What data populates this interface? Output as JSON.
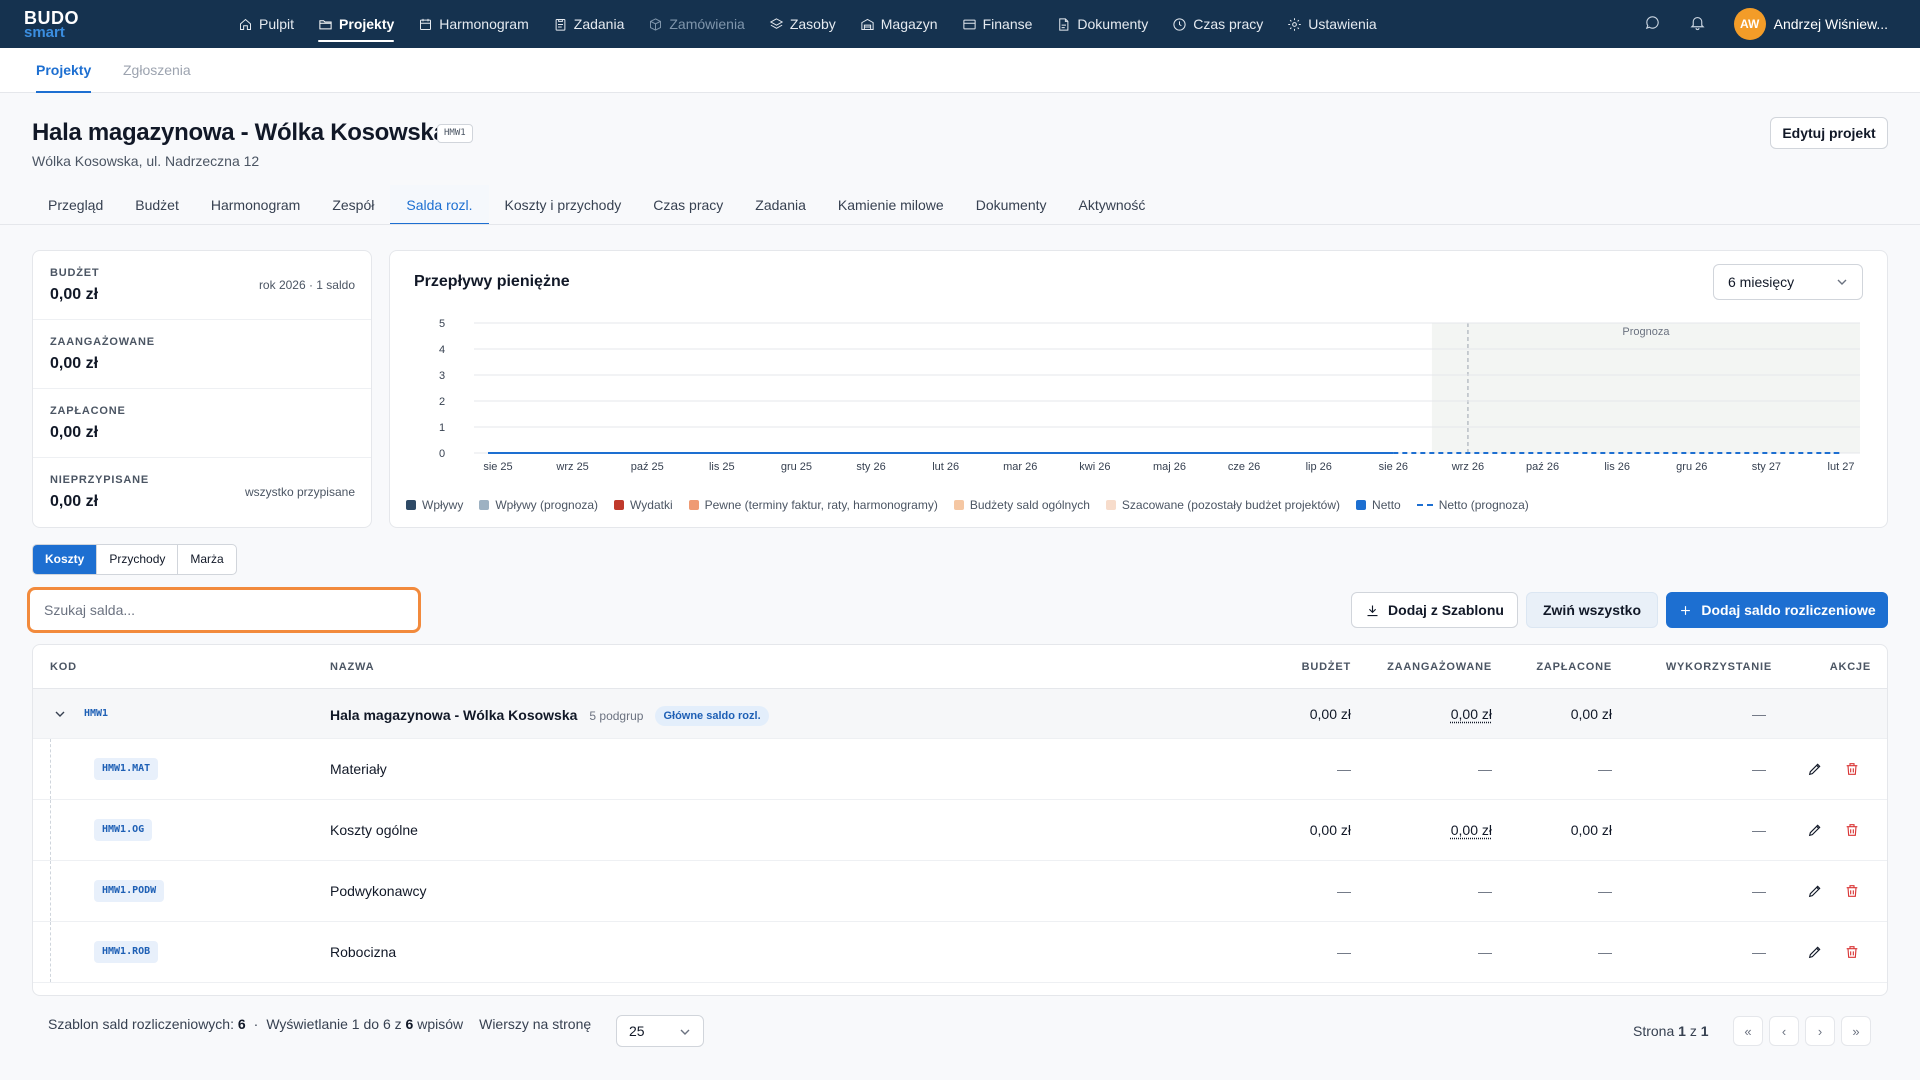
{
  "brand": {
    "line1": "BUDO",
    "line2": "smart"
  },
  "nav": {
    "items": [
      {
        "label": "Pulpit",
        "icon": "home-icon"
      },
      {
        "label": "Projekty",
        "icon": "folder-icon"
      },
      {
        "label": "Harmonogram",
        "icon": "calendar-icon"
      },
      {
        "label": "Zadania",
        "icon": "clipboard-icon"
      },
      {
        "label": "Zamówienia",
        "icon": "package-icon"
      },
      {
        "label": "Zasoby",
        "icon": "layers-icon"
      },
      {
        "label": "Magazyn",
        "icon": "warehouse-icon"
      },
      {
        "label": "Finanse",
        "icon": "credit-card-icon"
      },
      {
        "label": "Dokumenty",
        "icon": "document-icon"
      },
      {
        "label": "Czas pracy",
        "icon": "clock-icon"
      },
      {
        "label": "Ustawienia",
        "icon": "gear-icon"
      }
    ],
    "active": "Projekty",
    "user": {
      "initials": "AW",
      "name": "Andrzej Wiśniew..."
    }
  },
  "subtabs": [
    "Projekty",
    "Zgłoszenia"
  ],
  "project": {
    "title": "Hala magazynowa - Wólka Kosowska",
    "code": "HMW1",
    "address": "Wólka Kosowska, ul. Nadrzeczna 12",
    "edit_label": "Edytuj projekt"
  },
  "project_tabs": [
    "Przegląd",
    "Budżet",
    "Harmonogram",
    "Zespół",
    "Salda rozl.",
    "Koszty i przychody",
    "Czas pracy",
    "Zadania",
    "Kamienie milowe",
    "Dokumenty",
    "Aktywność"
  ],
  "summary": [
    {
      "label": "BUDŻET",
      "value": "0,00 zł",
      "note": "rok 2026 · 1 saldo"
    },
    {
      "label": "ZAANGAŻOWANE",
      "value": "0,00 zł",
      "note": ""
    },
    {
      "label": "ZAPŁACONE",
      "value": "0,00 zł",
      "note": ""
    },
    {
      "label": "NIEPRZYPISANE",
      "value": "0,00 zł",
      "note": "wszystko przypisane"
    }
  ],
  "chart_panel": {
    "title": "Przepływy pieniężne",
    "period": "6 miesięcy"
  },
  "chart_data": {
    "type": "line",
    "categories": [
      "sie 25",
      "wrz 25",
      "paź 25",
      "lis 25",
      "gru 25",
      "sty 26",
      "lut 26",
      "mar 26",
      "kwi 26",
      "maj 26",
      "cze 26",
      "lip 26",
      "sie 26",
      "wrz 26",
      "paź 26",
      "lis 26",
      "gru 26",
      "sty 27",
      "lut 27"
    ],
    "ylim": [
      0,
      5
    ],
    "yticks": [
      0,
      1,
      2,
      3,
      4,
      5
    ],
    "forecast_start": "wrz 26",
    "forecast_label": "Prognoza",
    "series": [
      {
        "name": "Netto",
        "values": [
          0,
          0,
          0,
          0,
          0,
          0,
          0,
          0,
          0,
          0,
          0,
          0,
          0,
          null,
          null,
          null,
          null,
          null,
          null
        ],
        "color": "#1d6fd1"
      },
      {
        "name": "Netto (prognoza)",
        "values": [
          null,
          null,
          null,
          null,
          null,
          null,
          null,
          null,
          null,
          null,
          null,
          null,
          0,
          0,
          0,
          0,
          0,
          0,
          0
        ],
        "color": "#1d6fd1",
        "dashed": true
      }
    ],
    "legend": [
      {
        "name": "Wpływy",
        "color": "#2e4a66"
      },
      {
        "name": "Wpływy (prognoza)",
        "color": "#9db1c2"
      },
      {
        "name": "Wydatki",
        "color": "#c0392b"
      },
      {
        "name": "Pewne (terminy faktur, raty, harmonogramy)",
        "color": "#ef9a73"
      },
      {
        "name": "Budżety sald ogólnych",
        "color": "#f5c7a3"
      },
      {
        "name": "Szacowane (pozostały budżet projektów)",
        "color": "#f7dccb"
      },
      {
        "name": "Netto",
        "color": "#1d6fd1"
      },
      {
        "name": "Netto (prognoza)",
        "color": "#1d6fd1",
        "dashed": true
      }
    ]
  },
  "segments": [
    "Koszty",
    "Przychody",
    "Marża"
  ],
  "search": {
    "placeholder": "Szukaj salda..."
  },
  "actions": {
    "template": "Dodaj z Szablonu",
    "collapse": "Zwiń wszystko",
    "add": "Dodaj saldo rozliczeniowe"
  },
  "table": {
    "headers": {
      "code": "KOD",
      "name": "NAZWA",
      "budget": "BUDŻET",
      "committed": "ZAANGAŻOWANE",
      "paid": "ZAPŁACONE",
      "usage": "WYKORZYSTANIE",
      "actions": "AKCJE"
    },
    "main_row": {
      "code": "HMW1",
      "name": "Hala magazynowa - Wólka Kosowska",
      "subgroups": "5 podgrup",
      "badge": "Główne saldo rozl.",
      "budget": "0,00 zł",
      "committed": "0,00 zł",
      "paid": "0,00 zł",
      "usage": "—"
    },
    "rows": [
      {
        "code": "HMW1.MAT",
        "name": "Materiały",
        "budget": "—",
        "committed": "—",
        "paid": "—",
        "usage": "—"
      },
      {
        "code": "HMW1.OG",
        "name": "Koszty ogólne",
        "budget": "0,00 zł",
        "committed": "0,00 zł",
        "paid": "0,00 zł",
        "usage": "—"
      },
      {
        "code": "HMW1.PODW",
        "name": "Podwykonawcy",
        "budget": "—",
        "committed": "—",
        "paid": "—",
        "usage": "—"
      },
      {
        "code": "HMW1.ROB",
        "name": "Robocizna",
        "budget": "—",
        "committed": "—",
        "paid": "—",
        "usage": "—"
      }
    ]
  },
  "footer": {
    "template_label": "Szablon sald rozliczeniowych:",
    "template_count": "6",
    "sep": "·",
    "showing_pre": "Wyświetlanie 1 do 6 z",
    "showing_total": "6",
    "showing_post": "wpisów",
    "rows_label": "Wierszy na stronę",
    "rows_value": "25",
    "page_pre": "Strona",
    "page_current": "1",
    "page_mid": "z",
    "page_total": "1"
  },
  "colors": {
    "nav_bg": "#15324f",
    "accent": "#1d6fd1",
    "focus_ring": "#f28a3c",
    "danger": "#d93636"
  }
}
